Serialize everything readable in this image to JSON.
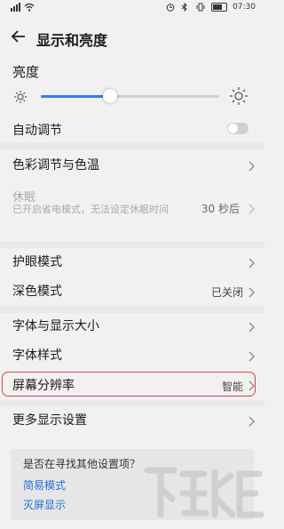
{
  "status_bar": {
    "time": "07:30"
  },
  "header": {
    "title": "显示和亮度"
  },
  "brightness": {
    "title": "亮度",
    "level_fraction": 0.39
  },
  "settings": {
    "auto_adjust": {
      "label": "自动调节",
      "enabled": false
    },
    "color": {
      "label": "色彩调节与色温"
    },
    "sleep": {
      "label": "休眠",
      "desc": "已开启省电模式，无法设定休眠时间",
      "value": "30 秒后"
    },
    "eye_care": {
      "label": "护眼模式"
    },
    "dark_mode": {
      "label": "深色模式",
      "value": "已关闭"
    },
    "font_size": {
      "label": "字体与显示大小"
    },
    "font_style": {
      "label": "字体样式"
    },
    "resolution": {
      "label": "屏幕分辨率",
      "value": "智能"
    },
    "more": {
      "label": "更多显示设置"
    }
  },
  "search_card": {
    "question": "是否在寻找其他设置项？",
    "link1": "简易模式",
    "link2": "灭屏显示"
  },
  "colors": {
    "accent": "#2a7dff",
    "link": "#1e6ce0",
    "highlight": "#d8404b"
  }
}
